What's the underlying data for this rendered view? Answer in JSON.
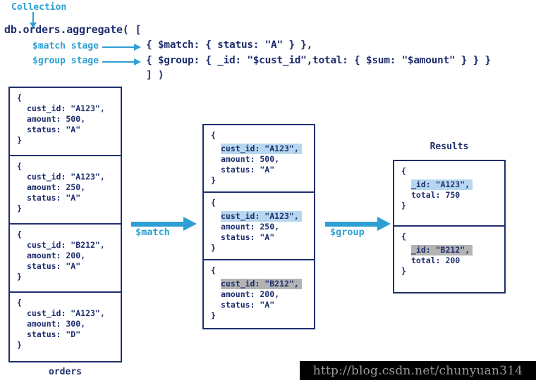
{
  "header": {
    "collection_label": "Collection",
    "aggregate_call": "db.orders.aggregate( [",
    "match_stage_label": "$match stage",
    "group_stage_label": "$group stage",
    "pipeline_match": "{ $match: { status: \"A\" } },",
    "pipeline_group": "{ $group: { _id: \"$cust_id\",total: { $sum: \"$amount\" } } }",
    "pipeline_close": "] )"
  },
  "orders": {
    "caption": "orders",
    "docs": [
      {
        "open": "{",
        "cust_id": "cust_id: \"A123\",",
        "amount": "amount: 500,",
        "status": "status: \"A\"",
        "close": "}"
      },
      {
        "open": "{",
        "cust_id": "cust_id: \"A123\",",
        "amount": "amount: 250,",
        "status": "status: \"A\"",
        "close": "}"
      },
      {
        "open": "{",
        "cust_id": "cust_id: \"B212\",",
        "amount": "amount: 200,",
        "status": "status: \"A\"",
        "close": "}"
      },
      {
        "open": "{",
        "cust_id": "cust_id: \"A123\",",
        "amount": "amount: 300,",
        "status": "status: \"D\"",
        "close": "}"
      }
    ]
  },
  "matched": {
    "docs": [
      {
        "open": "{",
        "cust_id": "cust_id: \"A123\",",
        "amount": "amount: 500,",
        "status": "status: \"A\"",
        "close": "}",
        "highlight": "#b6d7ef"
      },
      {
        "open": "{",
        "cust_id": "cust_id: \"A123\",",
        "amount": "amount: 250,",
        "status": "status: \"A\"",
        "close": "}",
        "highlight": "#b6d7ef"
      },
      {
        "open": "{",
        "cust_id": "cust_id: \"B212\",",
        "amount": "amount: 200,",
        "status": "status: \"A\"",
        "close": "}",
        "highlight": "#b3b3b3"
      }
    ]
  },
  "results": {
    "caption": "Results",
    "docs": [
      {
        "open": "{",
        "id": "_id: \"A123\",",
        "total": "total: 750",
        "close": "}",
        "highlight": "#b6d7ef"
      },
      {
        "open": "{",
        "id": "_id: \"B212\",",
        "total": "total: 200",
        "close": "}",
        "highlight": "#b3b3b3"
      }
    ]
  },
  "arrows": {
    "match_label": "$match",
    "group_label": "$group"
  },
  "watermark": {
    "url": "http://blog.csdn.net/chunyuan314"
  },
  "colors": {
    "code_navy": "#1f2f6e",
    "accent_blue": "#2e9fd4",
    "highlight_blue": "#b6d7ef",
    "highlight_gray": "#b3b3b3",
    "watermark_bg": "#000000",
    "watermark_text": "#9b9b9b"
  }
}
